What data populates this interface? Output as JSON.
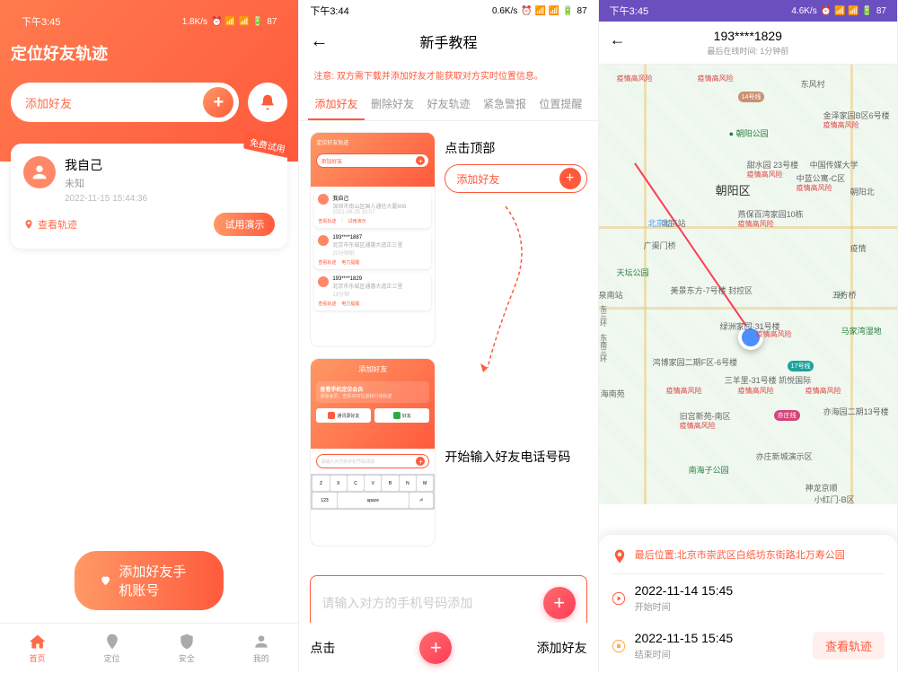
{
  "status": {
    "time": "下午3:45",
    "time2": "下午3:44",
    "time3": "下午3:45",
    "speed1": "1.8K/s",
    "speed2": "0.6K/s",
    "speed3": "4.6K/s",
    "battery": "87"
  },
  "screen1": {
    "title": "定位好友轨迹",
    "search_placeholder": "添加好友",
    "badge": "免费试用",
    "profile": {
      "name": "我自己",
      "status": "未知",
      "timestamp": "2022-11-15 15:44:36"
    },
    "view_track": "查看轨迹",
    "demo_btn": "试用演示",
    "add_friend_btn": "添加好友手机账号",
    "nav": {
      "home": "首页",
      "location": "定位",
      "safety": "安全",
      "mine": "我的"
    }
  },
  "screen2": {
    "title": "新手教程",
    "notice": "注意: 双方需下载并添加好友才能获取对方实时位置信息。",
    "tabs": {
      "add": "添加好友",
      "delete": "删除好友",
      "track": "好友轨迹",
      "alert": "紧急警报",
      "remind": "位置提醒"
    },
    "hint1": "点击顶部",
    "hint1_input": "添加好友",
    "preview": {
      "title": "定位好友轨迹",
      "search": "添加好友",
      "p1_name": "我自己",
      "p1_addr": "深圳市南山区国人通信大厦808",
      "p1_time": "2021-09-25 10:07",
      "p2_name": "193****1887",
      "p2_addr": "北京市东城区通惠大道正三里",
      "p2_time": "20分钟前",
      "p3_name": "193****1829",
      "p3_addr": "北京市东城区通惠大道正三里",
      "p3_time": "19分钟",
      "link1": "查看轨迹",
      "link2": "电力提醒",
      "link3": "试用演示"
    },
    "preview2": {
      "title": "添加好友",
      "card_title": "查看手机定位会员",
      "card_sub": "添加会员，查看实时位置和行动轨迹",
      "chip1": "通讯录好友",
      "chip2": "好友",
      "input": "请输入对方的手机号码添加"
    },
    "hint2": "开始输入好友电话号码",
    "input_placeholder": "请输入对方的手机号码添加",
    "bottom_hint1": "点击",
    "bottom_hint2": "添加好友"
  },
  "screen3": {
    "phone": "193****1829",
    "subtitle": "最后在线时间: 1分钟前",
    "location_label": "最后位置:",
    "location": "北京市崇武区白纸坊东街路北万寿公园",
    "start_time": "2022-11-14 15:45",
    "start_label": "开始时间",
    "end_time": "2022-11-15 15:45",
    "end_label": "结束时间",
    "view_btn": "查看轨迹",
    "map_labels": {
      "chaoyang": "朝阳区",
      "beijing": "北京站",
      "tiantan": "天坛公园",
      "guangqu": "广渠门桥",
      "wufang": "五方桥",
      "l1": "疫情高风险",
      "l2": "疫情高风险",
      "l3": "金泽家园B区6号楼",
      "l4": "甜水园 23号楼",
      "l5": "中国传媒大学",
      "l6": "中蓝公寓-C区",
      "l7": "燕保百湾家园10栋",
      "l8": "美景东方-7号楼 封控区",
      "l9": "绿洲家园-31号楼",
      "l10": "鸿博家园二期F区-6号楼",
      "l11": "三羊里-31号楼 凯悦国际",
      "l12": "旧宫新苑-南区",
      "l13": "亦庄新城演示区",
      "l14": "神龙京顺",
      "l15": "马家湾湿地",
      "l16": "南海子公园",
      "l17": "东风村",
      "l18": "朝阳北",
      "l19": "东三环",
      "l20": "海南苑",
      "l21": "东南三环",
      "l22": "亦庄线",
      "l23": "14号线",
      "l24": "17号线",
      "l25": "泉南站",
      "l26": "亦海园二期13号楼",
      "l27": "小红门-B区"
    }
  }
}
